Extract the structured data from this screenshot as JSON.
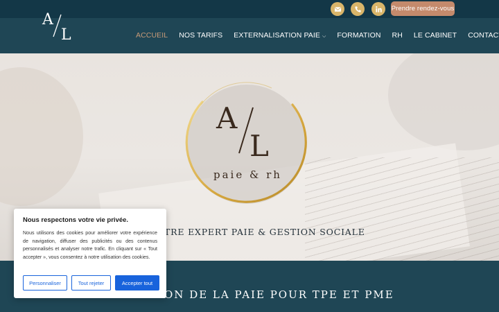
{
  "topbar": {
    "icons": [
      "mail-icon",
      "phone-icon",
      "linkedin-icon"
    ],
    "cta_label": "Prendre rendez-vous"
  },
  "logo": {
    "text": "A/L"
  },
  "nav": {
    "items": [
      {
        "label": "ACCUEIL",
        "active": true
      },
      {
        "label": "NOS TARIFS"
      },
      {
        "label": "EXTERNALISATION PAIE",
        "has_dropdown": true
      },
      {
        "label": "FORMATION"
      },
      {
        "label": "RH"
      },
      {
        "label": "LE CABINET"
      },
      {
        "label": "CONTACT"
      }
    ]
  },
  "hero": {
    "emblem_letters": "A/L",
    "emblem_subtitle": "paie & rh",
    "title": "OTRE EXPERT PAIE & GESTION SOCIALE"
  },
  "section2": {
    "title": "ON DE LA PAIE POUR TPE ET PME"
  },
  "cookie": {
    "title": "Nous respectons votre vie privée.",
    "text": "Nous utilisons des cookies pour améliorer votre expérience de navigation, diffuser des publicités ou des contenus personnalisés et analyser notre trafic. En cliquant sur « Tout accepter », vous consentez à notre utilisation des cookies.",
    "customize_label": "Personnaliser",
    "reject_label": "Tout rejeter",
    "accept_label": "Accepter tout"
  },
  "colors": {
    "brand_dark": "#1f4655",
    "topbar": "#133747",
    "gold": "#d9b56a",
    "cta": "#c48a6c",
    "nav_active": "#c89b78",
    "cookie_blue": "#1863dc"
  }
}
